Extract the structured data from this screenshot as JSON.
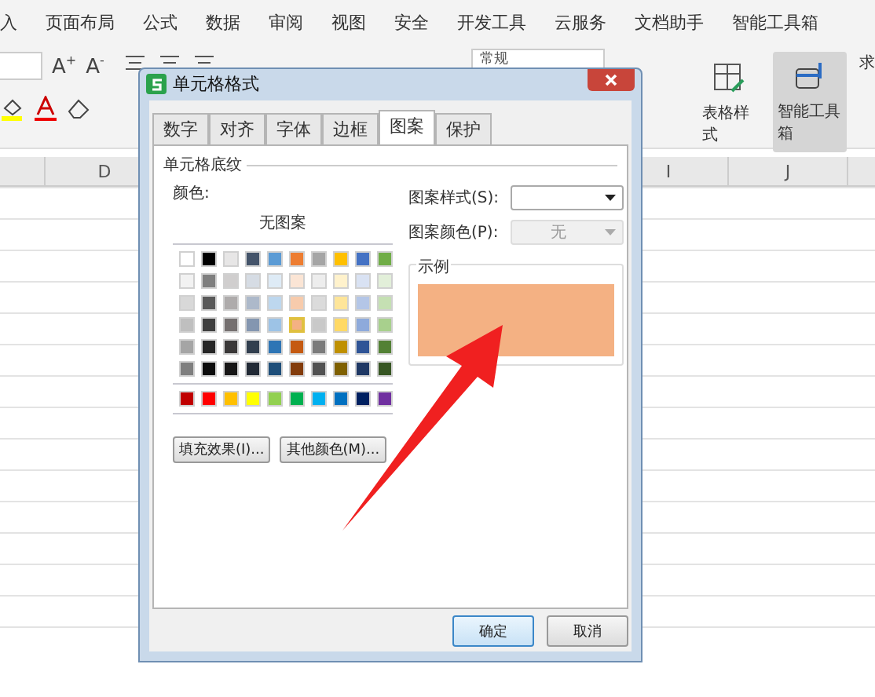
{
  "menu": [
    {
      "label": "入",
      "selected": false
    },
    {
      "label": "页面布局",
      "selected": false
    },
    {
      "label": "公式",
      "selected": false
    },
    {
      "label": "数据",
      "selected": false
    },
    {
      "label": "审阅",
      "selected": false
    },
    {
      "label": "视图",
      "selected": false
    },
    {
      "label": "安全",
      "selected": false
    },
    {
      "label": "开发工具",
      "selected": false
    },
    {
      "label": "云服务",
      "selected": false
    },
    {
      "label": "文档助手",
      "selected": false
    },
    {
      "label": "智能工具箱",
      "selected": false
    }
  ],
  "toolbar": {
    "font_buttons": [
      {
        "letter": "A",
        "sign": "+"
      },
      {
        "letter": "A",
        "sign": "-"
      }
    ],
    "number_format": "常规",
    "table_style": "表格样式",
    "toolbox": {
      "label": "智能工具箱",
      "selected": true
    },
    "edge_label": "求"
  },
  "sheet": {
    "columns": [
      "D",
      "I",
      "J"
    ]
  },
  "dialog": {
    "title": "单元格格式",
    "tabs": [
      {
        "label": "数字",
        "selected": false
      },
      {
        "label": "对齐",
        "selected": false
      },
      {
        "label": "字体",
        "selected": false
      },
      {
        "label": "边框",
        "selected": false
      },
      {
        "label": "图案",
        "selected": true
      },
      {
        "label": "保护",
        "selected": false
      }
    ],
    "group": "单元格底纹",
    "color_label": "颜色:",
    "no_pattern": "无图案",
    "palette": [
      {
        "kind": "theme",
        "swatches": [
          {
            "color": "#ffffff",
            "selected": false
          },
          {
            "color": "#000000",
            "selected": false
          },
          {
            "color": "#e7e6e6",
            "selected": false
          },
          {
            "color": "#44546a",
            "selected": false
          },
          {
            "color": "#5b9bd5",
            "selected": false
          },
          {
            "color": "#ed7d31",
            "selected": false
          },
          {
            "color": "#a5a5a5",
            "selected": false
          },
          {
            "color": "#ffc000",
            "selected": false
          },
          {
            "color": "#4472c4",
            "selected": false
          },
          {
            "color": "#70ad47",
            "selected": false
          }
        ]
      },
      {
        "kind": "tint",
        "swatches": [
          {
            "color": "#f2f2f2",
            "selected": false
          },
          {
            "color": "#7f7f7f",
            "selected": false
          },
          {
            "color": "#d0cece",
            "selected": false
          },
          {
            "color": "#d6dce4",
            "selected": false
          },
          {
            "color": "#deebf6",
            "selected": false
          },
          {
            "color": "#fbe5d5",
            "selected": false
          },
          {
            "color": "#ededed",
            "selected": false
          },
          {
            "color": "#fff2cc",
            "selected": false
          },
          {
            "color": "#d9e2f3",
            "selected": false
          },
          {
            "color": "#e2efd9",
            "selected": false
          }
        ]
      },
      {
        "kind": "tint",
        "swatches": [
          {
            "color": "#d8d8d8",
            "selected": false
          },
          {
            "color": "#595959",
            "selected": false
          },
          {
            "color": "#aeabab",
            "selected": false
          },
          {
            "color": "#adb9ca",
            "selected": false
          },
          {
            "color": "#bdd7ee",
            "selected": false
          },
          {
            "color": "#f7cbac",
            "selected": false
          },
          {
            "color": "#dbdbdb",
            "selected": false
          },
          {
            "color": "#fee599",
            "selected": false
          },
          {
            "color": "#b4c6e7",
            "selected": false
          },
          {
            "color": "#c5e0b3",
            "selected": false
          }
        ]
      },
      {
        "kind": "tint",
        "swatches": [
          {
            "color": "#bfbfbf",
            "selected": false
          },
          {
            "color": "#3f3f3f",
            "selected": false
          },
          {
            "color": "#757070",
            "selected": false
          },
          {
            "color": "#8496b0",
            "selected": false
          },
          {
            "color": "#9dc3e6",
            "selected": false
          },
          {
            "color": "#f4b183",
            "selected": true
          },
          {
            "color": "#c9c9c9",
            "selected": false
          },
          {
            "color": "#ffd965",
            "selected": false
          },
          {
            "color": "#8eaadb",
            "selected": false
          },
          {
            "color": "#a8d08d",
            "selected": false
          }
        ]
      },
      {
        "kind": "tint",
        "swatches": [
          {
            "color": "#a5a5a5",
            "selected": false
          },
          {
            "color": "#262626",
            "selected": false
          },
          {
            "color": "#3a3838",
            "selected": false
          },
          {
            "color": "#323f4f",
            "selected": false
          },
          {
            "color": "#2e75b5",
            "selected": false
          },
          {
            "color": "#c55a11",
            "selected": false
          },
          {
            "color": "#7b7b7b",
            "selected": false
          },
          {
            "color": "#bf9000",
            "selected": false
          },
          {
            "color": "#2f5496",
            "selected": false
          },
          {
            "color": "#538135",
            "selected": false
          }
        ]
      },
      {
        "kind": "tint",
        "swatches": [
          {
            "color": "#7f7f7f",
            "selected": false
          },
          {
            "color": "#0c0c0c",
            "selected": false
          },
          {
            "color": "#171616",
            "selected": false
          },
          {
            "color": "#222a35",
            "selected": false
          },
          {
            "color": "#1e4e79",
            "selected": false
          },
          {
            "color": "#833c0b",
            "selected": false
          },
          {
            "color": "#525252",
            "selected": false
          },
          {
            "color": "#7f6000",
            "selected": false
          },
          {
            "color": "#1f3864",
            "selected": false
          },
          {
            "color": "#375623",
            "selected": false
          }
        ]
      },
      {
        "kind": "standard",
        "swatches": [
          {
            "color": "#c00000",
            "selected": false
          },
          {
            "color": "#ff0000",
            "selected": false
          },
          {
            "color": "#ffc000",
            "selected": false
          },
          {
            "color": "#ffff00",
            "selected": false
          },
          {
            "color": "#92d050",
            "selected": false
          },
          {
            "color": "#00b050",
            "selected": false
          },
          {
            "color": "#00b0f0",
            "selected": false
          },
          {
            "color": "#0070c0",
            "selected": false
          },
          {
            "color": "#002060",
            "selected": false
          },
          {
            "color": "#7030a0",
            "selected": false
          }
        ]
      }
    ],
    "fill_effects": "填充效果(I)...",
    "more_colors": "其他颜色(M)...",
    "pattern_style_label": "图案样式(S):",
    "pattern_color_label": "图案颜色(P):",
    "pattern_color": {
      "value": "无",
      "disabled": true
    },
    "sample_label": "示例",
    "ok": "确定",
    "cancel": "取消"
  }
}
